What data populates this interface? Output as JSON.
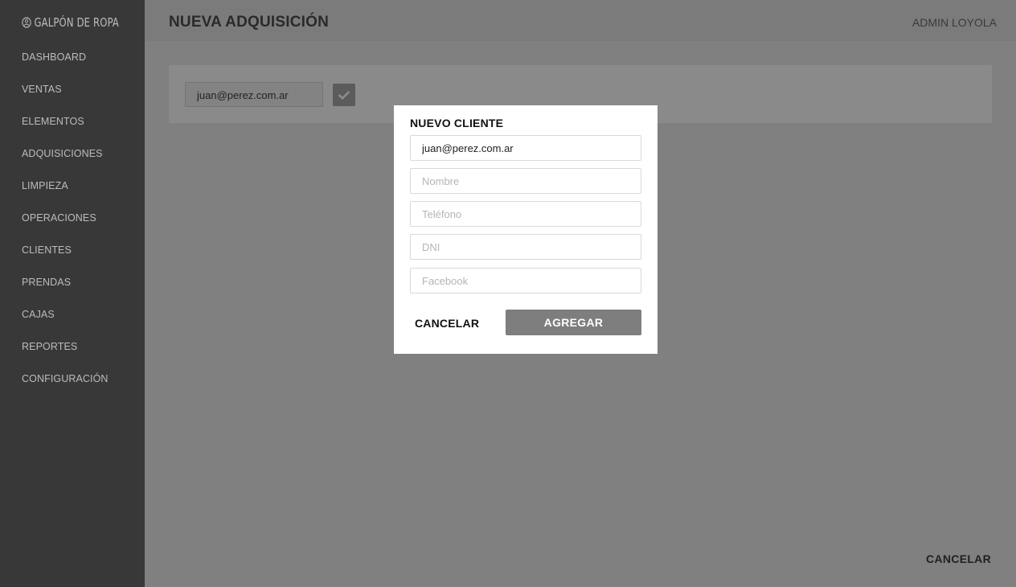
{
  "sidebar": {
    "brand": "GALPÓN DE ROPA",
    "brand_icon": "circle-logo-icon",
    "items": [
      {
        "label": "DASHBOARD"
      },
      {
        "label": "VENTAS"
      },
      {
        "label": "ELEMENTOS"
      },
      {
        "label": "ADQUISICIONES"
      },
      {
        "label": "LIMPIEZA"
      },
      {
        "label": "OPERACIONES"
      },
      {
        "label": "CLIENTES"
      },
      {
        "label": "PRENDAS"
      },
      {
        "label": "CAJAS"
      },
      {
        "label": "REPORTES"
      },
      {
        "label": "CONFIGURACIÓN"
      }
    ]
  },
  "header": {
    "title": "NUEVA ADQUISICIÓN",
    "user": "ADMIN LOYOLA"
  },
  "main": {
    "client_email": "juan@perez.com.ar",
    "confirm_icon": "check-icon",
    "cancel_label": "CANCELAR"
  },
  "modal": {
    "title": "NUEVO CLIENTE",
    "email_value": "juan@perez.com.ar",
    "name_placeholder": "Nombre",
    "phone_placeholder": "Teléfono",
    "dni_placeholder": "DNI",
    "facebook_placeholder": "Facebook",
    "cancel_label": "CANCELAR",
    "add_label": "AGREGAR"
  },
  "colors": {
    "sidebar_bg": "#383838",
    "overlay_bg": "#808080",
    "modal_bg": "#ffffff",
    "primary_button": "#7e7e7e"
  }
}
